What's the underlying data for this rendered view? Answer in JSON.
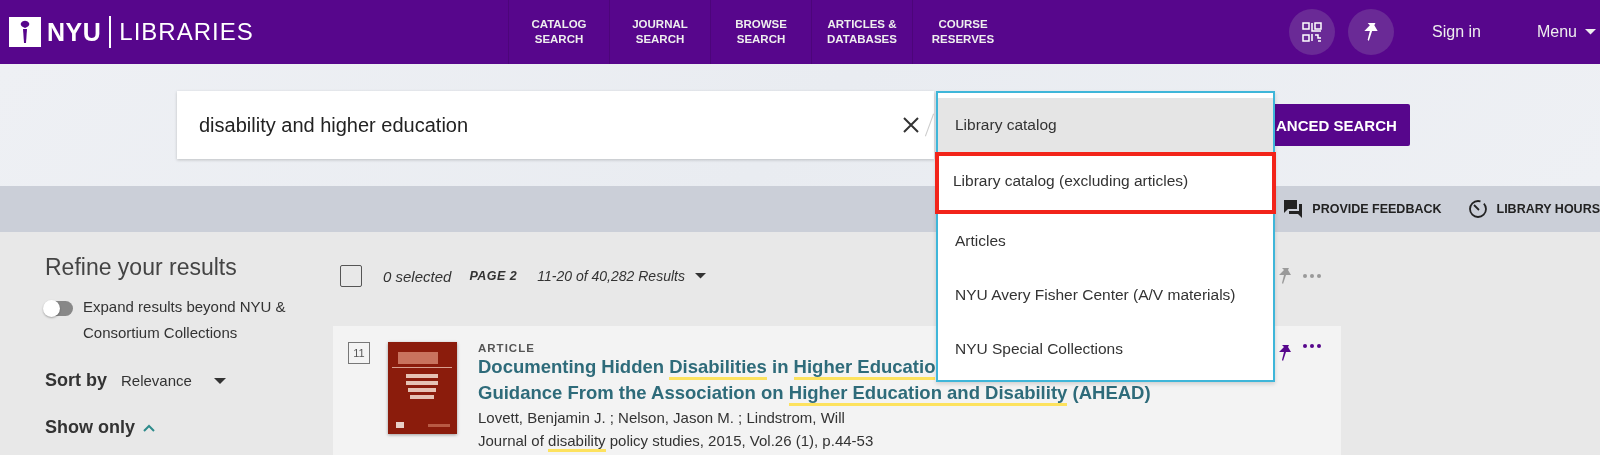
{
  "header": {
    "logo": {
      "brand": "NYU",
      "name": "LIBRARIES"
    },
    "nav": [
      {
        "line1": "CATALOG",
        "line2": "SEARCH"
      },
      {
        "line1": "JOURNAL",
        "line2": "SEARCH"
      },
      {
        "line1": "BROWSE",
        "line2": "SEARCH"
      },
      {
        "line1": "ARTICLES &",
        "line2": "DATABASES"
      },
      {
        "line1": "COURSE",
        "line2": "RESERVES"
      }
    ],
    "sign_in": "Sign in",
    "menu": "Menu"
  },
  "search": {
    "value": "disability and higher education",
    "advanced_button": "ANCED SEARCH",
    "scope_options": [
      {
        "label": "Library catalog",
        "selected": true,
        "outlined": false
      },
      {
        "label": "Library catalog (excluding articles)",
        "selected": false,
        "outlined": true
      },
      {
        "label": "Articles",
        "selected": false,
        "outlined": false
      },
      {
        "label": "NYU Avery Fisher Center (A/V materials)",
        "selected": false,
        "outlined": false
      },
      {
        "label": "NYU Special Collections",
        "selected": false,
        "outlined": false
      }
    ]
  },
  "toolbar": {
    "feedback": "PROVIDE FEEDBACK",
    "hours": "LIBRARY HOURS"
  },
  "sidebar": {
    "title": "Refine your results",
    "expand_toggle": {
      "label": "Expand results beyond NYU & Consortium Collections",
      "on": false
    },
    "sort": {
      "label": "Sort by",
      "value": "Relevance"
    },
    "show_only": {
      "label": "Show only",
      "expanded": true
    }
  },
  "results": {
    "select_all": {
      "checked": false
    },
    "selected_count": "0 selected",
    "page": "PAGE 2",
    "range": "11-20 of 40,282 Results",
    "items": [
      {
        "number": "11",
        "type": "ARTICLE",
        "pinned": true,
        "title_lines": [
          [
            {
              "text": "Documenting Hidden ",
              "highlight": false
            },
            {
              "text": "Disabilities",
              "highlight": true
            },
            {
              "text": " in ",
              "highlight": false
            },
            {
              "text": "Higher Educatio",
              "highlight": true
            }
          ],
          [
            {
              "text": "Guidance From the Association on ",
              "highlight": false
            },
            {
              "text": "Higher Education and Disability",
              "highlight": true
            },
            {
              "text": " (AHEAD)",
              "highlight": false
            }
          ]
        ],
        "authors": "Lovett, Benjamin J. ; Nelson, Jason M. ; Lindstrom, Will",
        "source": [
          {
            "text": "Journal of ",
            "highlight": false
          },
          {
            "text": "disability",
            "highlight": true
          },
          {
            "text": " policy studies, 2015, Vol.26 (1), p.44-53",
            "highlight": false
          }
        ]
      }
    ]
  }
}
